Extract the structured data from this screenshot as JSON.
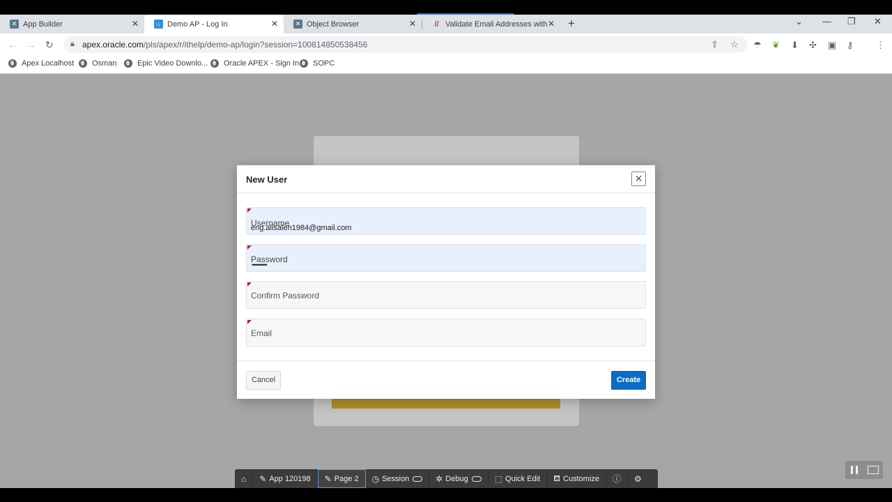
{
  "browser": {
    "tabs": [
      {
        "title": "App Builder",
        "icon": "apex-builder-icon",
        "active": false
      },
      {
        "title": "Demo AP - Log In",
        "icon": "apex-app-icon",
        "active": true
      },
      {
        "title": "Object Browser",
        "icon": "apex-builder-icon",
        "active": false
      },
      {
        "title": "Validate Email Addresses with Re",
        "icon": "slashes-icon",
        "active": false
      }
    ],
    "url_host": "apex.oracle.com",
    "url_path": "/pls/apex/r/ithelp/demo-ap/login?session=100814850538456",
    "bookmarks": [
      "Apex Localhost",
      "Osman",
      "Epic Video Downlo...",
      "Oracle APEX - Sign In",
      "SOPC"
    ]
  },
  "dialog": {
    "title": "New User",
    "fields": {
      "username": {
        "label": "Username",
        "value": "eng.alisaleh1984@gmail.com"
      },
      "password": {
        "label": "Password",
        "value": "••••••••••"
      },
      "confirm_password": {
        "label": "Confirm Password",
        "value": ""
      },
      "email": {
        "label": "Email",
        "value": ""
      }
    },
    "cancel_label": "Cancel",
    "create_label": "Create"
  },
  "devbar": {
    "app": "App 120198",
    "page": "Page 2",
    "session": "Session",
    "debug": "Debug",
    "quick_edit": "Quick Edit",
    "customize": "Customize"
  },
  "colors": {
    "primary_button": "#0a6dc2",
    "required_marker": "#b71c1c",
    "page_overlay": "#a6a6a6",
    "devbar": "#3b3b3b"
  }
}
